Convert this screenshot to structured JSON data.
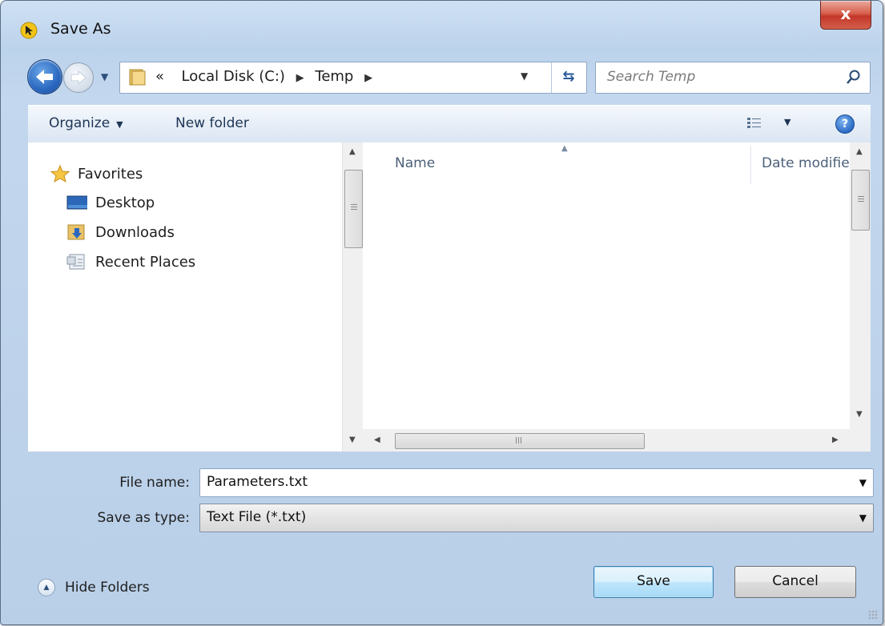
{
  "window": {
    "title": "Save As",
    "close_label": "x"
  },
  "address": {
    "overflow": "«",
    "crumbs": [
      "Local Disk (C:)",
      "Temp"
    ]
  },
  "search": {
    "placeholder": "Search Temp"
  },
  "toolbar": {
    "organize_label": "Organize",
    "new_folder_label": "New folder",
    "help_label": "?"
  },
  "sidebar": {
    "items": [
      {
        "label": "Favorites",
        "icon": "star-icon"
      },
      {
        "label": "Desktop",
        "icon": "desktop-icon"
      },
      {
        "label": "Downloads",
        "icon": "downloads-folder-icon"
      },
      {
        "label": "Recent Places",
        "icon": "recent-places-icon"
      }
    ]
  },
  "file_list": {
    "columns": [
      "Name",
      "Date modifie"
    ],
    "rows": []
  },
  "form": {
    "file_name_label": "File name:",
    "file_name_value": "Parameters.txt",
    "save_type_label": "Save as type:",
    "save_type_value": "Text File (*.txt)"
  },
  "footer": {
    "hide_folders_label": "Hide Folders",
    "save_label": "Save",
    "cancel_label": "Cancel"
  },
  "colors": {
    "chrome": "#c3d7ee",
    "accent": "#2a68c0",
    "close": "#c3372a"
  }
}
